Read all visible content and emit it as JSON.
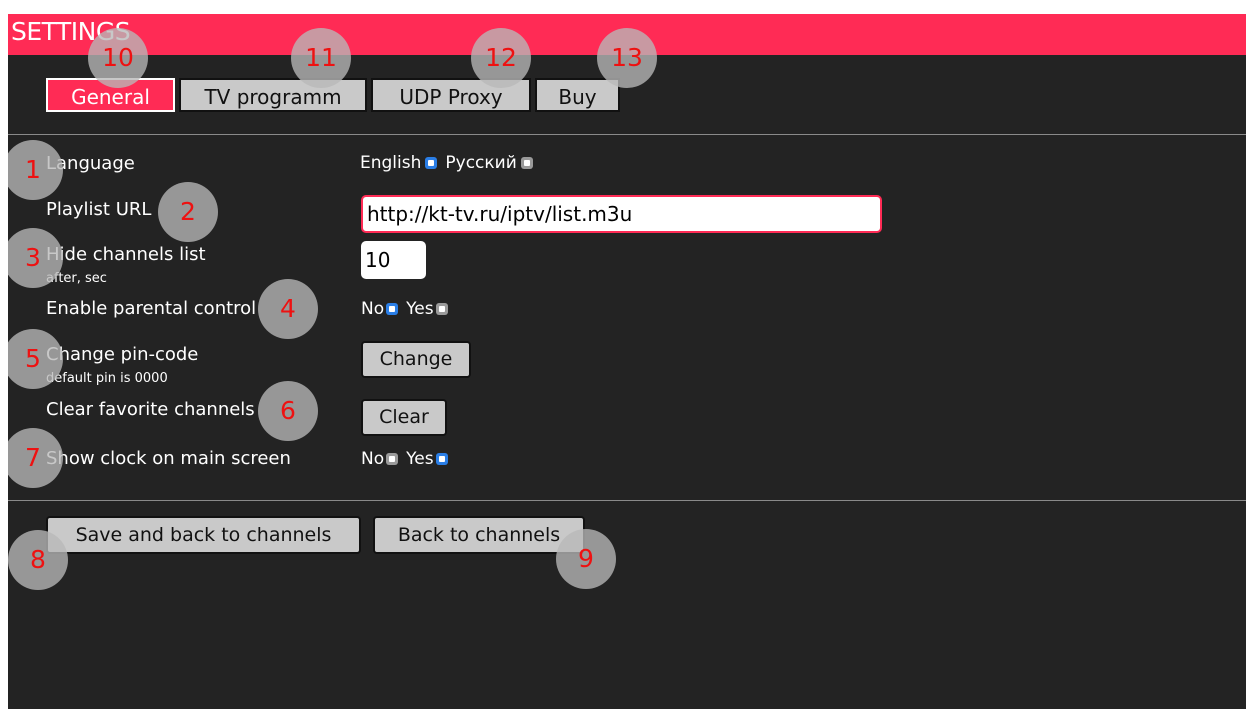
{
  "header": {
    "title": "SETTINGS"
  },
  "tabs": [
    {
      "label": "General",
      "active": true
    },
    {
      "label": "TV programm",
      "active": false
    },
    {
      "label": "UDP Proxy",
      "active": false
    },
    {
      "label": "Buy",
      "active": false
    }
  ],
  "settings": {
    "language": {
      "label": "Language",
      "options": [
        {
          "label": "English",
          "selected": true
        },
        {
          "label": "Русский",
          "selected": false
        }
      ]
    },
    "playlist": {
      "label": "Playlist URL",
      "value": "http://kt-tv.ru/iptv/list.m3u"
    },
    "hide_channels": {
      "label": "Hide channels list",
      "sublabel": "after, sec",
      "value": "10"
    },
    "parental": {
      "label": "Enable parental control",
      "options": [
        {
          "label": "No",
          "selected": true
        },
        {
          "label": "Yes",
          "selected": false
        }
      ]
    },
    "pin": {
      "label": "Change pin-code",
      "sublabel": "default pin is 0000",
      "button": "Change"
    },
    "favorites": {
      "label": "Clear favorite channels",
      "button": "Clear"
    },
    "clock": {
      "label": "Show clock on main screen",
      "options": [
        {
          "label": "No",
          "selected": false
        },
        {
          "label": "Yes",
          "selected": true
        }
      ]
    }
  },
  "footer": {
    "save_back": "Save and back to channels",
    "back": "Back to channels"
  },
  "callouts": [
    "1",
    "2",
    "3",
    "4",
    "5",
    "6",
    "7",
    "8",
    "9",
    "10",
    "11",
    "12",
    "13"
  ],
  "colors": {
    "accent": "#ff2b55",
    "radio_on": "#2a7ee6",
    "background": "#232323",
    "callout_text": "#ee1111"
  }
}
